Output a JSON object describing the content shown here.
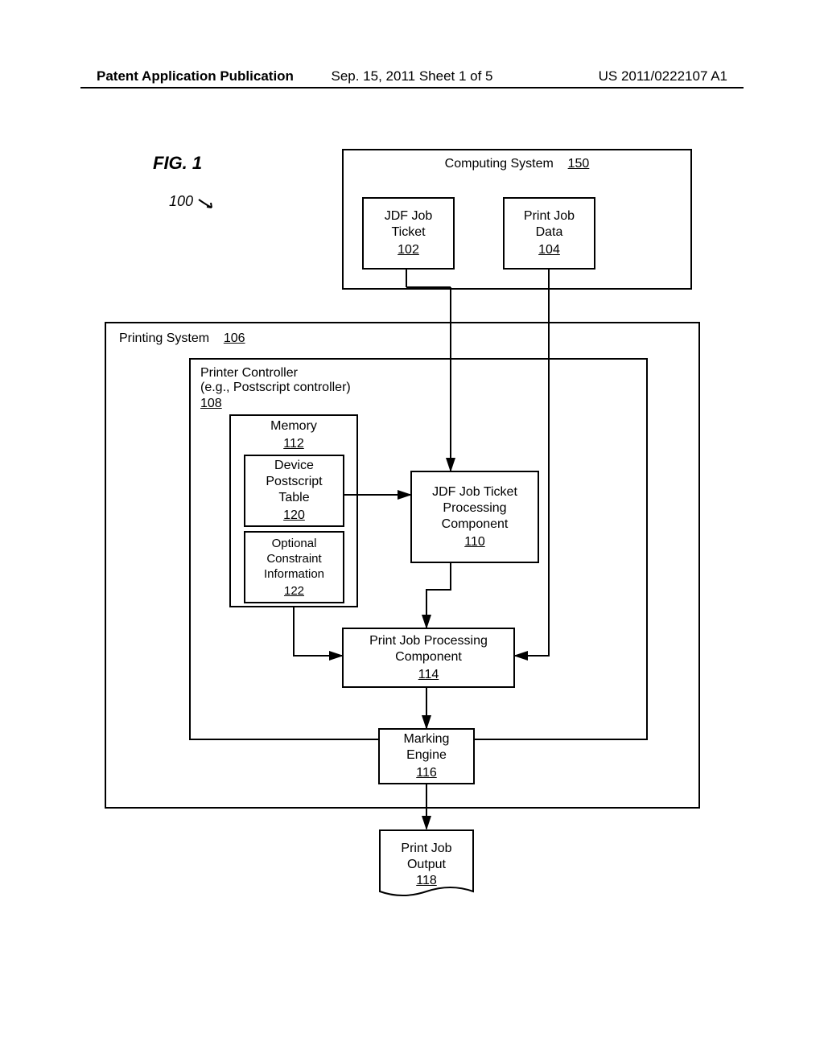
{
  "header": {
    "left": "Patent Application Publication",
    "center": "Sep. 15, 2011   Sheet 1 of 5",
    "right": "US 2011/0222107 A1"
  },
  "diagram": {
    "figure_label": "FIG. 1",
    "ref_100": "100",
    "computing_system": {
      "title": "Computing System",
      "ref": "150"
    },
    "jdf_ticket": {
      "line1": "JDF Job",
      "line2": "Ticket",
      "ref": "102"
    },
    "print_data": {
      "line1": "Print Job",
      "line2": "Data",
      "ref": "104"
    },
    "printing_system": {
      "title": "Printing System",
      "ref": "106"
    },
    "printer_controller": {
      "line1": "Printer Controller",
      "line2": "(e.g., Postscript controller)",
      "ref": "108"
    },
    "memory": {
      "title": "Memory",
      "ref": "112"
    },
    "device_table": {
      "line1": "Device",
      "line2": "Postscript",
      "line3": "Table",
      "ref": "120"
    },
    "constraint": {
      "line1": "Optional",
      "line2": "Constraint",
      "line3": "Information",
      "ref": "122"
    },
    "jdf_processing": {
      "line1": "JDF Job Ticket",
      "line2": "Processing",
      "line3": "Component",
      "ref": "110"
    },
    "print_processing": {
      "line1": "Print Job Processing",
      "line2": "Component",
      "ref": "114"
    },
    "marking": {
      "line1": "Marking",
      "line2": "Engine",
      "ref": "116"
    },
    "output": {
      "line1": "Print Job",
      "line2": "Output",
      "ref": "118"
    }
  }
}
